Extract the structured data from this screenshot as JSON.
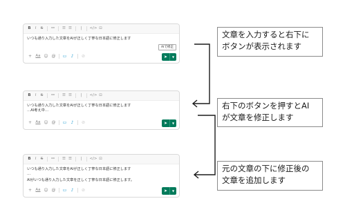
{
  "formatting_toolbar": {
    "icons": [
      "bold-icon",
      "italic-icon",
      "strikethrough-icon",
      "link-icon",
      "ordered-list-icon",
      "bulleted-list-icon",
      "blockquote-icon",
      "code-icon",
      "code-block-icon"
    ],
    "glyphs": {
      "bold": "B",
      "italic": "I",
      "strike": "S",
      "link": "⚯",
      "olist": "☰",
      "ulist": "☰",
      "quote": "❘",
      "code": "</>",
      "codeblock": "⊡"
    }
  },
  "composer_bottom": {
    "glyphs": {
      "plus": "+",
      "format": "Aa",
      "emoji": "☺",
      "mention": "@",
      "video": "▭",
      "audio": "♪",
      "shortcut": "⊘",
      "send": "➤",
      "dropdown": "▼"
    }
  },
  "composers": [
    {
      "lines": [
        "いつも通り入力した文章をAIが正しく丁寧な日本語に修正します"
      ],
      "ai_button_label": "AIで修正"
    },
    {
      "lines": [
        "いつも通り入力した文章をAIが正しく丁寧な日本語に修正します",
        "…AI考え中…"
      ]
    },
    {
      "lines": [
        "いつも通り入力した文章をAIが正しく丁寧な日本語に修正します",
        "…",
        "AIがいつも通り入力した文章を正しく丁寧な日本語に修正します。"
      ]
    }
  ],
  "callouts": [
    {
      "lines": [
        "文章を入力すると右下に",
        "ボタンが表示されます"
      ]
    },
    {
      "lines": [
        "右下のボタンを押すとAI",
        "が文章を修正します"
      ]
    },
    {
      "lines": [
        "元の文章の下に修正後の",
        "文章を追加します"
      ]
    }
  ],
  "colors": {
    "send_button": "#007a5a",
    "border": "#d9d9d9",
    "icon_active": "#1d9bd1",
    "connector": "#1a1a1a"
  }
}
